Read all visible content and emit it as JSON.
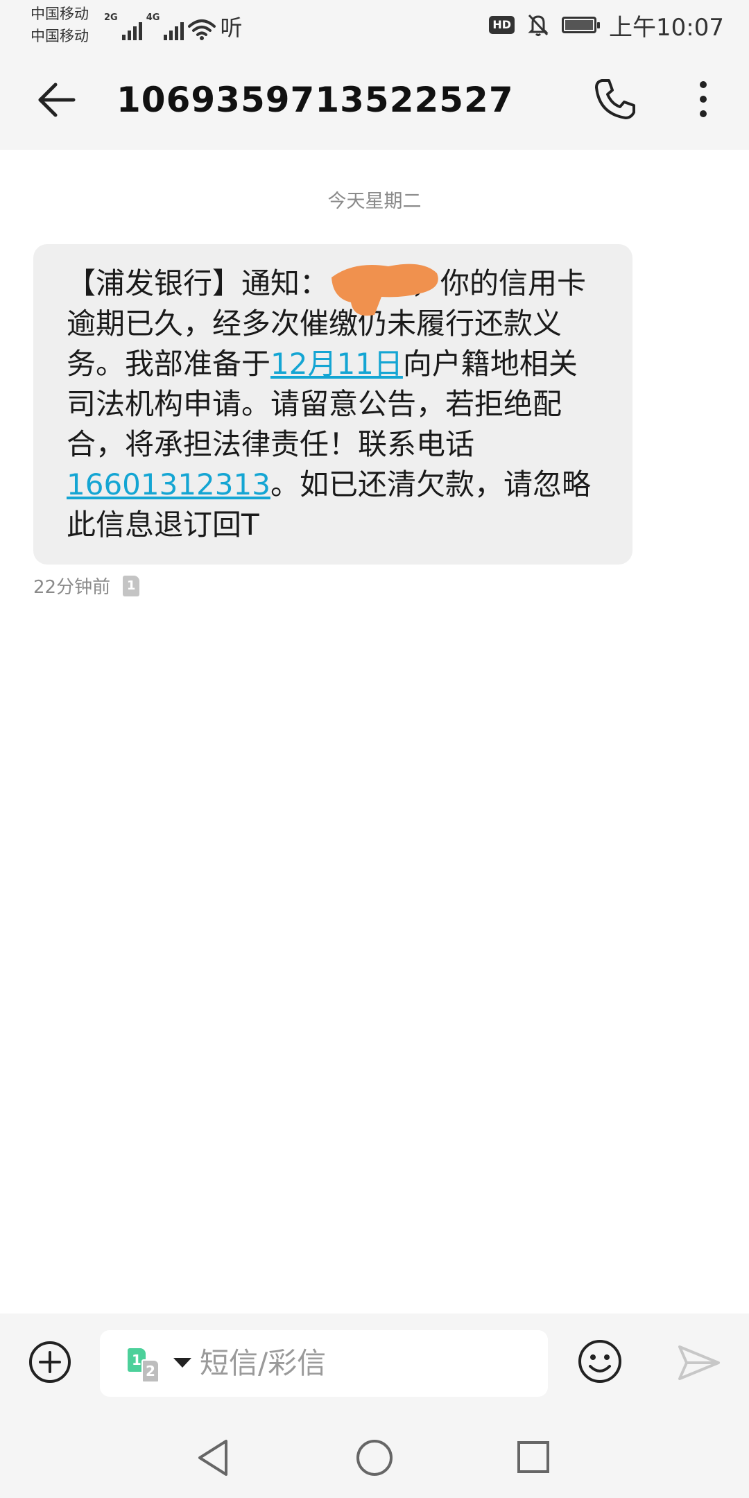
{
  "status_bar": {
    "carrier_1": "中国移动",
    "carrier_2": "中国移动",
    "network_1": "2G",
    "network_2": "4G",
    "listen_label": "听",
    "hd_label": "HD",
    "time": "上午10:07"
  },
  "header": {
    "title": "1069359713522527"
  },
  "conversation": {
    "date_label": "今天星期二",
    "message": {
      "part_1": "【浦发银行】通知：",
      "part_2": "，你的信用卡逾期已久，经多次催缴仍未履行还款义务。我部准备于",
      "link_date": "12月11日",
      "part_3": "向户籍地相关司法机构申请。请留意公告，若拒绝配合，将承担法律责任！联系电话",
      "link_phone": "16601312313",
      "part_4": "。如已还清欠款，请忽略此信息退订回T"
    },
    "timestamp": "22分钟前",
    "sim_number": "1"
  },
  "composer": {
    "placeholder": "短信/彩信",
    "sim_1": "1",
    "sim_2": "2"
  },
  "colors": {
    "link": "#14a5d3",
    "bubble": "#efefef",
    "redaction": "#f0914e",
    "sim_1_badge": "#4cd09a"
  }
}
